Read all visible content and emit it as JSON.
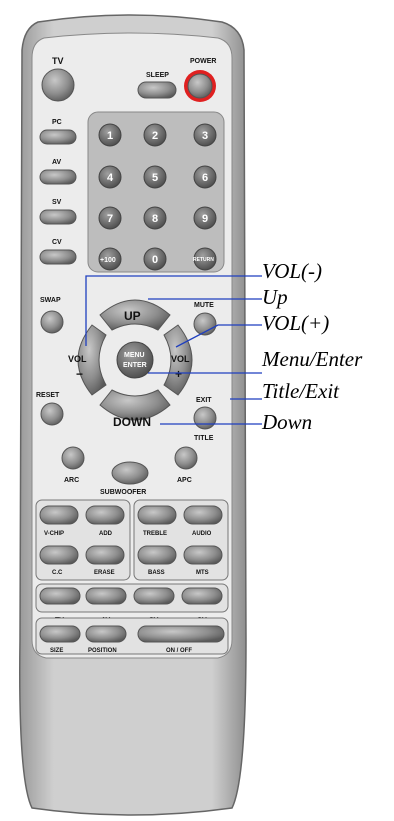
{
  "remote": {
    "tv": "TV",
    "sleep": "SLEEP",
    "power": "POWER",
    "pc": "PC",
    "av": "AV",
    "sv": "SV",
    "cv": "CV",
    "numbers": [
      "1",
      "2",
      "3",
      "4",
      "5",
      "6",
      "7",
      "8",
      "9"
    ],
    "plus100": "+100",
    "zero": "0",
    "return": "RETURN",
    "swap": "SWAP",
    "up": "UP",
    "mute": "MUTE",
    "vol": "VOL",
    "minus": "−",
    "plus": "+",
    "menu": "MENU",
    "enter": "ENTER",
    "reset": "RESET",
    "exit": "EXIT",
    "down": "DOWN",
    "title": "TITLE",
    "arc": "ARC",
    "apc": "APC",
    "subwoofer": "SUBWOOFER",
    "vchip": "V-CHIP",
    "add": "ADD",
    "treble": "TREBLE",
    "audio": "AUDIO",
    "cc": "C.C",
    "erase": "ERASE",
    "bass": "BASS",
    "mts": "MTS",
    "src_tv": "TV",
    "src_av": "AV",
    "src_sv": "SV",
    "src_cv": "CV",
    "size": "SIZE",
    "position": "POSITION",
    "onoff": "ON / OFF"
  },
  "callouts": {
    "vol_minus": "VOL(-)",
    "up": "Up",
    "vol_plus": "VOL(+)",
    "menu_enter": "Menu/Enter",
    "title_exit": "Title/Exit",
    "down": "Down"
  },
  "colors": {
    "body": "#c9c9c9",
    "panel": "#ececec",
    "button": "#8a8a8a",
    "power_ring": "#e02020",
    "leader": "#1f3fbf"
  }
}
